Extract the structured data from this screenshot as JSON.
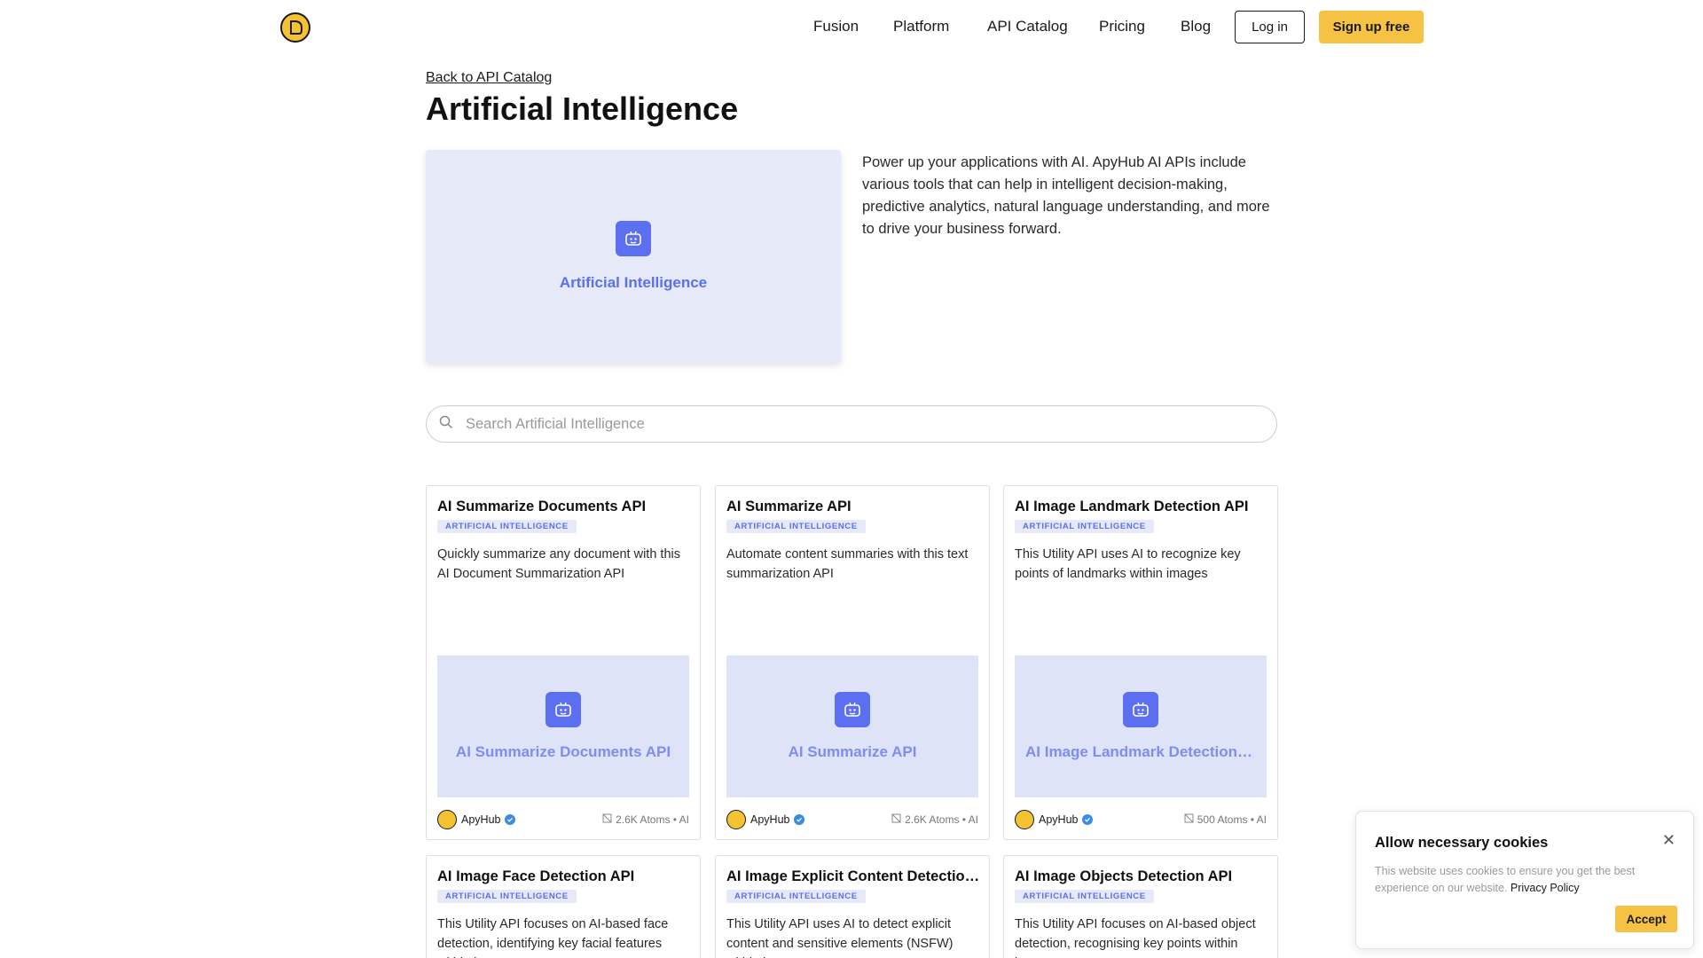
{
  "header": {
    "nav": [
      {
        "label": "Fusion"
      },
      {
        "label": "Platform"
      },
      {
        "label": "API Catalog"
      },
      {
        "label": "Pricing"
      },
      {
        "label": "Blog"
      }
    ],
    "login_label": "Log in",
    "signup_label": "Sign up free"
  },
  "page": {
    "back_link": "Back to API Catalog",
    "title": "Artificial Intelligence",
    "hero_label": "Artificial Intelligence",
    "description": "Power up your applications with AI. ApyHub AI APIs include various tools that can help in intelligent decision-making, predictive analytics, natural language understanding, and more to drive your business forward."
  },
  "search": {
    "placeholder": "Search Artificial Intelligence"
  },
  "cards": [
    {
      "title": "AI Summarize Documents API",
      "badge": "ARTIFICIAL INTELLIGENCE",
      "description": "Quickly summarize any document with this AI Document Summarization API",
      "thumb_label": "AI Summarize Documents API",
      "author": "ApyHub",
      "meta": "2.6K Atoms • AI"
    },
    {
      "title": "AI Summarize API",
      "badge": "ARTIFICIAL INTELLIGENCE",
      "description": "Automate content summaries with this text summarization API",
      "thumb_label": "AI Summarize API",
      "author": "ApyHub",
      "meta": "2.6K Atoms • AI"
    },
    {
      "title": "AI Image Landmark Detection API",
      "badge": "ARTIFICIAL INTELLIGENCE",
      "description": "This Utility API uses AI to recognize key points of landmarks within images",
      "thumb_label": "AI Image Landmark Detection API",
      "author": "ApyHub",
      "meta": "500 Atoms • AI"
    },
    {
      "title": "AI Image Face Detection API",
      "badge": "ARTIFICIAL INTELLIGENCE",
      "description": "This Utility API focuses on AI-based face detection, identifying key facial features within images"
    },
    {
      "title": "AI Image Explicit Content Detection API",
      "badge": "ARTIFICIAL INTELLIGENCE",
      "description": "This Utility API uses AI to detect explicit content and sensitive elements (NSFW) within images"
    },
    {
      "title": "AI Image Objects Detection API",
      "badge": "ARTIFICIAL INTELLIGENCE",
      "description": "This Utility API focuses on AI-based object detection, recognising key points within images"
    }
  ],
  "cookie": {
    "title": "Allow necessary cookies",
    "text": "This website uses cookies to ensure you get the best experience on our website.",
    "privacy_link": "Privacy Policy",
    "accept_label": "Accept"
  },
  "colors": {
    "accent_yellow": "#f5c243",
    "brand_blue": "#5b6ff0",
    "thumb_bg": "#dfe3f7"
  }
}
